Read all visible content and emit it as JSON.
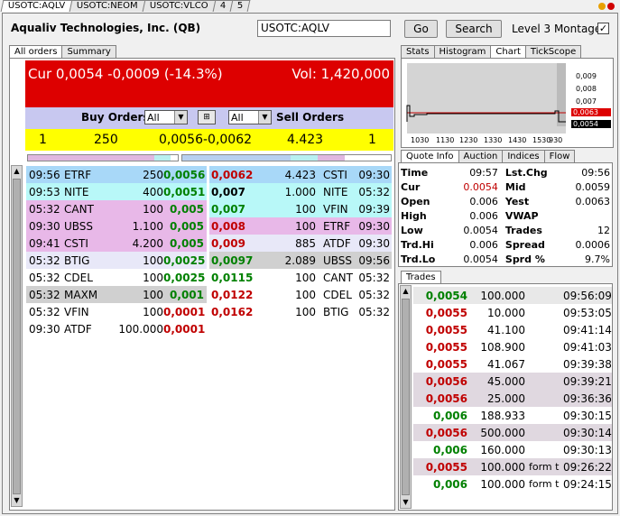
{
  "top_tabs": [
    "USOTC:AQLV",
    "USOTC:NEOM",
    "USOTC:VLCO",
    "4",
    "5"
  ],
  "header": {
    "company": "Aqualiv Technologies, Inc. (QB)",
    "symbol_value": "USOTC:AQLV",
    "go_label": "Go",
    "search_label": "Search",
    "montage_label": "Level 3 Montage",
    "montage_checked": "✓"
  },
  "left_tabs": [
    "All orders",
    "Summary"
  ],
  "summary": {
    "cur": "Cur 0,0054 -0,0009 (-14.3%)",
    "vol": "Vol: 1,420,000",
    "buy_label": "Buy Orders",
    "sell_label": "Sell Orders",
    "buy_filter": "All",
    "sell_filter": "All",
    "buy_count": "1",
    "buy_size": "250",
    "spread": "0,0056-0,0062",
    "sell_size": "4.423",
    "sell_count": "1"
  },
  "bids": [
    {
      "time": "09:56",
      "mm": "ETRF",
      "size": "250",
      "price": "0,0056"
    },
    {
      "time": "09:53",
      "mm": "NITE",
      "size": "400",
      "price": "0,0051"
    },
    {
      "time": "05:32",
      "mm": "CANT",
      "size": "100",
      "price": "0,005"
    },
    {
      "time": "09:30",
      "mm": "UBSS",
      "size": "1.100",
      "price": "0,005"
    },
    {
      "time": "09:41",
      "mm": "CSTI",
      "size": "4.200",
      "price": "0,005"
    },
    {
      "time": "05:32",
      "mm": "BTIG",
      "size": "100",
      "price": "0,0025"
    },
    {
      "time": "05:32",
      "mm": "CDEL",
      "size": "100",
      "price": "0,0025"
    },
    {
      "time": "05:32",
      "mm": "MAXM",
      "size": "100",
      "price": "0,001"
    },
    {
      "time": "05:32",
      "mm": "VFIN",
      "size": "100",
      "price": "0,0001"
    },
    {
      "time": "09:30",
      "mm": "ATDF",
      "size": "100.000",
      "price": "0,0001"
    }
  ],
  "asks": [
    {
      "price": "0,0062",
      "size": "4.423",
      "mm": "CSTI",
      "time": "09:30"
    },
    {
      "price": "0,007",
      "size": "1.000",
      "mm": "NITE",
      "time": "05:32"
    },
    {
      "price": "0,007",
      "size": "100",
      "mm": "VFIN",
      "time": "09:39"
    },
    {
      "price": "0,008",
      "size": "100",
      "mm": "ETRF",
      "time": "09:30"
    },
    {
      "price": "0,009",
      "size": "885",
      "mm": "ATDF",
      "time": "09:30"
    },
    {
      "price": "0,0097",
      "size": "2.089",
      "mm": "UBSS",
      "time": "09:56"
    },
    {
      "price": "0,0115",
      "size": "100",
      "mm": "CANT",
      "time": "05:32"
    },
    {
      "price": "0,0122",
      "size": "100",
      "mm": "CDEL",
      "time": "05:32"
    },
    {
      "price": "0,0162",
      "size": "100",
      "mm": "BTIG",
      "time": "05:32"
    }
  ],
  "right_tabs": [
    "Stats",
    "Histogram",
    "Chart",
    "TickScope"
  ],
  "chart": {
    "x_labels": [
      "1030",
      "1130",
      "1230",
      "1330",
      "1430",
      "1530",
      "930"
    ],
    "y_labels": [
      "0,009",
      "0,008",
      "0,007",
      "0,0063",
      "0,0054"
    ]
  },
  "quote_tabs": [
    "Quote Info",
    "Auction",
    "Indices",
    "Flow"
  ],
  "quote": [
    {
      "k1": "Time",
      "v1": "09:57",
      "k2": "Lst.Chg",
      "v2": "09:56"
    },
    {
      "k1": "Cur",
      "v1": "0.0054",
      "k2": "Mid",
      "v2": "0.0059"
    },
    {
      "k1": "Open",
      "v1": "0.006",
      "k2": "Yest",
      "v2": "0.0063"
    },
    {
      "k1": "High",
      "v1": "0.006",
      "k2": "VWAP",
      "v2": ""
    },
    {
      "k1": "Low",
      "v1": "0.0054",
      "k2": "Trades",
      "v2": "12"
    },
    {
      "k1": "Trd.Hi",
      "v1": "0.006",
      "k2": "Spread",
      "v2": "0.0006"
    },
    {
      "k1": "Trd.Lo",
      "v1": "0.0054",
      "k2": "Sprd %",
      "v2": "9.7%"
    }
  ],
  "trades_tab": "Trades",
  "trades": [
    {
      "price": "0,0054",
      "size": "100.000",
      "cond": "",
      "time": "09:56:09",
      "color": "green"
    },
    {
      "price": "0,0055",
      "size": "10.000",
      "cond": "",
      "time": "09:53:05",
      "color": "red"
    },
    {
      "price": "0,0055",
      "size": "41.100",
      "cond": "",
      "time": "09:41:14",
      "color": "red"
    },
    {
      "price": "0,0055",
      "size": "108.900",
      "cond": "",
      "time": "09:41:03",
      "color": "red"
    },
    {
      "price": "0,0055",
      "size": "41.067",
      "cond": "",
      "time": "09:39:38",
      "color": "red"
    },
    {
      "price": "0,0056",
      "size": "45.000",
      "cond": "",
      "time": "09:39:21",
      "color": "red"
    },
    {
      "price": "0,0056",
      "size": "25.000",
      "cond": "",
      "time": "09:36:36",
      "color": "red"
    },
    {
      "price": "0,006",
      "size": "188.933",
      "cond": "",
      "time": "09:30:15",
      "color": "green"
    },
    {
      "price": "0,0056",
      "size": "500.000",
      "cond": "",
      "time": "09:30:14",
      "color": "red"
    },
    {
      "price": "0,006",
      "size": "160.000",
      "cond": "",
      "time": "09:30:13",
      "color": "green"
    },
    {
      "price": "0,0055",
      "size": "100.000",
      "cond": "form t",
      "time": "09:26:22",
      "color": "red"
    },
    {
      "price": "0,006",
      "size": "100.000",
      "cond": "form t",
      "time": "09:24:15",
      "color": "green"
    }
  ]
}
